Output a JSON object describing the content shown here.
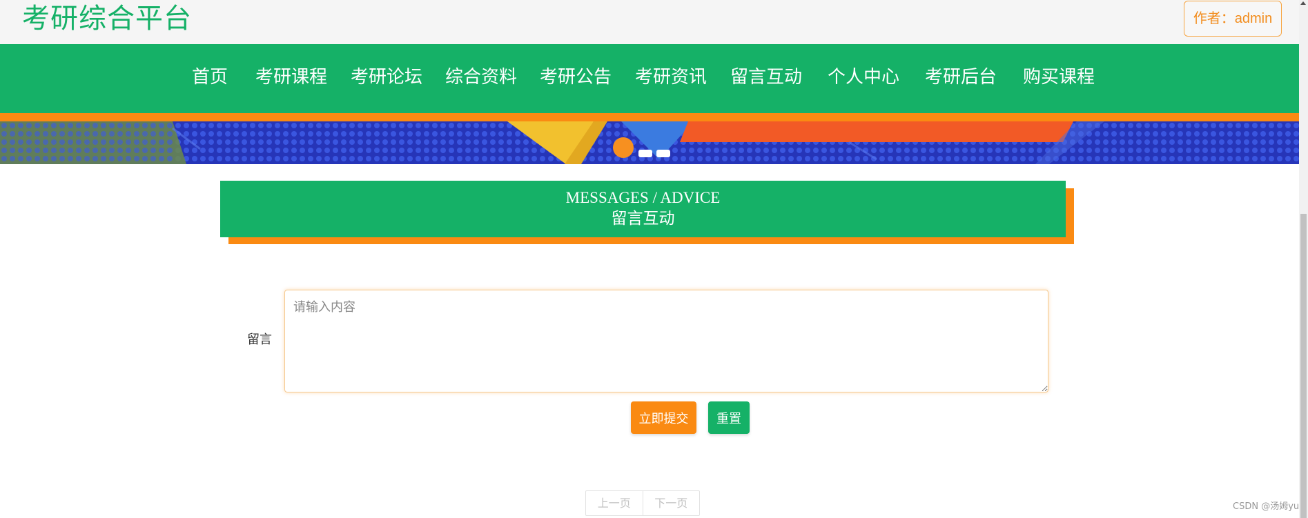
{
  "header": {
    "site_title": "考研综合平台",
    "author_label": "作者：admin"
  },
  "nav": {
    "items": [
      "首页",
      "考研课程",
      "考研论坛",
      "综合资料",
      "考研公告",
      "考研资讯",
      "留言互动",
      "个人中心",
      "考研后台",
      "购买课程"
    ]
  },
  "section": {
    "title_en": "MESSAGES / ADVICE",
    "title_cn": "留言互动"
  },
  "form": {
    "label": "留言",
    "placeholder": "请输入内容",
    "value": "",
    "submit_label": "立即提交",
    "reset_label": "重置"
  },
  "pager": {
    "prev_label": "上一页",
    "next_label": "下一页"
  },
  "watermark": "CSDN @汤姆yu",
  "colors": {
    "brand_green": "#15b167",
    "accent_orange": "#fa8a12",
    "banner_blue": "#2b3cc4"
  }
}
